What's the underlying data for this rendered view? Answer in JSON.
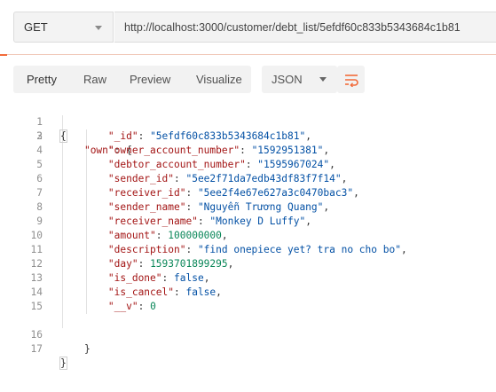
{
  "request": {
    "method": "GET",
    "url": "http://localhost:3000/customer/debt_list/5efdf60c833b5343684c1b81"
  },
  "view_tabs": [
    "Pretty",
    "Raw",
    "Preview",
    "Visualize"
  ],
  "format_select": "JSON",
  "line_numbers": [
    "1",
    "2",
    "3",
    "4",
    "5",
    "6",
    "7",
    "8",
    "9",
    "10",
    "11",
    "12",
    "13",
    "14",
    "15",
    "16",
    "17"
  ],
  "json": {
    "own_key": "\"own\"",
    "fields": [
      {
        "key": "\"_id\"",
        "value": "\"5efdf60c833b5343684c1b81\"",
        "type": "s"
      },
      {
        "key": "\"owner_account_number\"",
        "value": "\"1592951381\"",
        "type": "s"
      },
      {
        "key": "\"debtor_account_number\"",
        "value": "\"1595967024\"",
        "type": "s"
      },
      {
        "key": "\"sender_id\"",
        "value": "\"5ee2f71da7edb43df83f7f14\"",
        "type": "s"
      },
      {
        "key": "\"receiver_id\"",
        "value": "\"5ee2f4e67e627a3c0470bac3\"",
        "type": "s"
      },
      {
        "key": "\"sender_name\"",
        "value": "\"Nguyễn Trương Quang\"",
        "type": "s"
      },
      {
        "key": "\"receiver_name\"",
        "value": "\"Monkey D Luffy\"",
        "type": "s"
      },
      {
        "key": "\"amount\"",
        "value": "100000000",
        "type": "n"
      },
      {
        "key": "\"description\"",
        "value": "\"find onepiece yet? tra no cho bo\"",
        "type": "s"
      },
      {
        "key": "\"day\"",
        "value": "1593701899295",
        "type": "n"
      },
      {
        "key": "\"is_done\"",
        "value": "false",
        "type": "b"
      },
      {
        "key": "\"is_cancel\"",
        "value": "false",
        "type": "b"
      },
      {
        "key": "\"__v\"",
        "value": "0",
        "type": "n"
      }
    ]
  }
}
